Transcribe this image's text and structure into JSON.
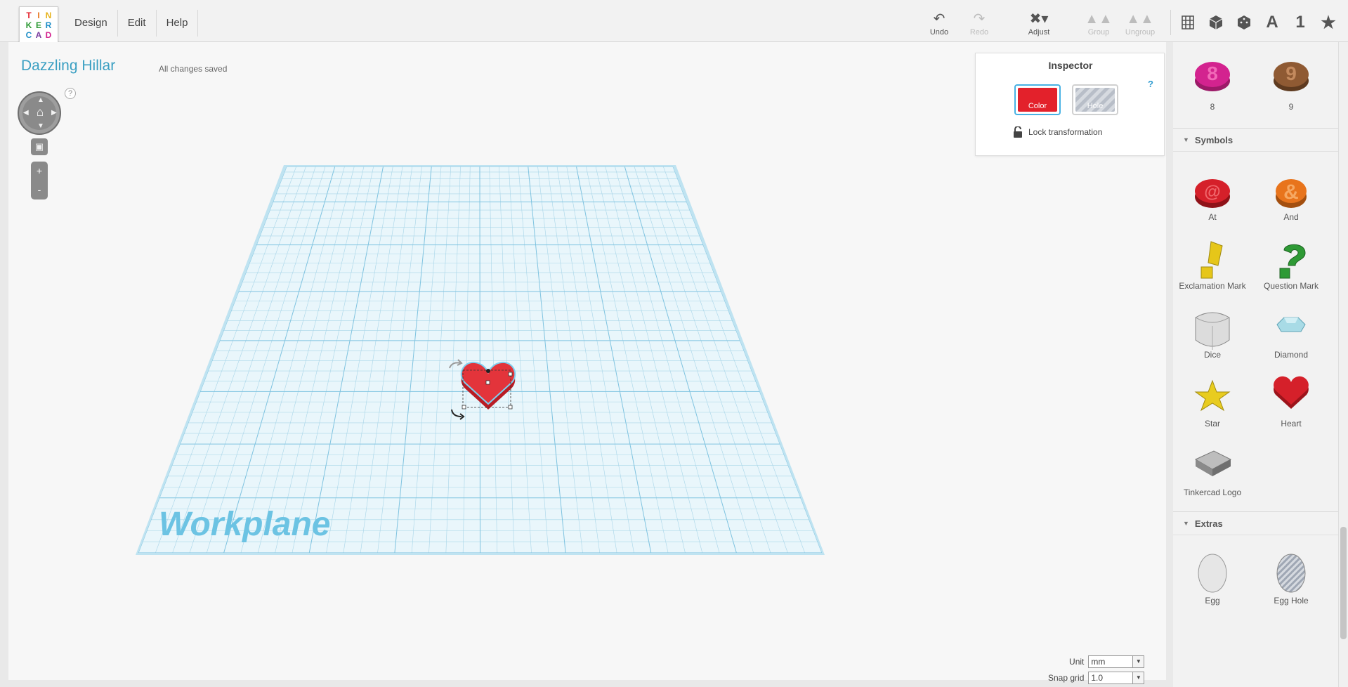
{
  "logo": {
    "letters": [
      "T",
      "I",
      "N",
      "K",
      "E",
      "R",
      "C",
      "A",
      "D"
    ]
  },
  "menu": [
    {
      "label": "Design"
    },
    {
      "label": "Edit"
    },
    {
      "label": "Help"
    }
  ],
  "toolbar": {
    "undo": "Undo",
    "redo": "Redo",
    "adjust": "Adjust",
    "group": "Group",
    "ungroup": "Ungroup"
  },
  "view_icons": {
    "letter": "A",
    "number": "1"
  },
  "document": {
    "title": "Dazzling Hillar",
    "status": "All changes saved"
  },
  "navigation": {
    "help": "?",
    "zoom_in": "+",
    "zoom_out": "-"
  },
  "workplane": {
    "label": "Workplane"
  },
  "inspector": {
    "title": "Inspector",
    "help": "?",
    "color_label": "Color",
    "hole_label": "Hole",
    "lock_label": "Lock transformation",
    "color_value": "#e3212b"
  },
  "unit_controls": {
    "unit_label": "Unit",
    "unit_value": "mm",
    "snap_label": "Snap grid",
    "snap_value": "1.0"
  },
  "sidebar": {
    "numbers": [
      {
        "name": "8",
        "color": "#d3238f"
      },
      {
        "name": "9",
        "color": "#8f5a33"
      }
    ],
    "symbols_header": "Symbols",
    "symbols": [
      {
        "name": "At",
        "color": "#d5202a"
      },
      {
        "name": "And",
        "color": "#e8741c"
      },
      {
        "name": "Exclamation Mark",
        "color": "#e6c619"
      },
      {
        "name": "Question Mark",
        "color": "#2e9a35"
      },
      {
        "name": "Dice",
        "color": "#dcdcdc"
      },
      {
        "name": "Diamond",
        "color": "#a8dbe6"
      },
      {
        "name": "Star",
        "color": "#e8cc20"
      },
      {
        "name": "Heart",
        "color": "#d5202a"
      },
      {
        "name": "Tinkercad Logo",
        "color": "#9a9a9a"
      }
    ],
    "extras_header": "Extras",
    "extras": [
      {
        "name": "Egg",
        "color": "#e6e6e6"
      },
      {
        "name": "Egg Hole",
        "color": "#b5bbc6"
      }
    ]
  }
}
